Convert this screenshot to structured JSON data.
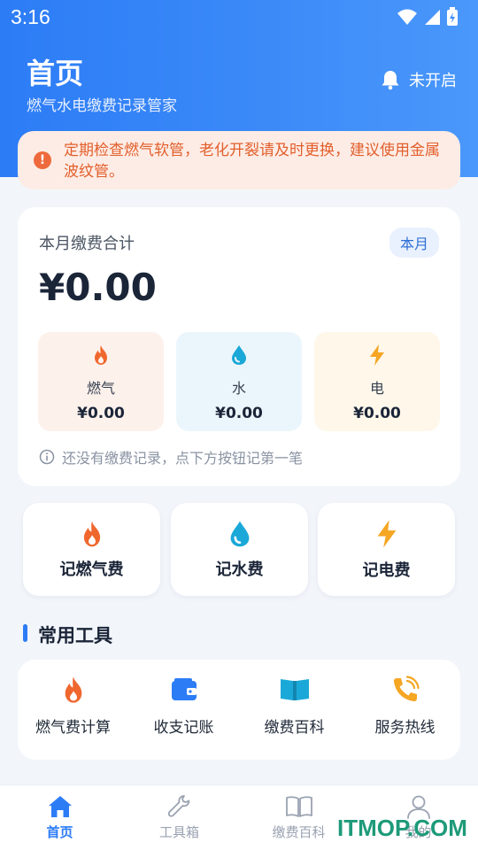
{
  "status_bar": {
    "time": "3:16"
  },
  "header": {
    "title": "首页",
    "subtitle": "燃气水电缴费记录管家",
    "reminder_label": "未开启"
  },
  "notice": {
    "icon": "alert-circle-icon",
    "text": "定期检查燃气软管，老化开裂请及时更换，建议使用金属波纹管。"
  },
  "summary": {
    "label": "本月缴费合计",
    "period": "本月",
    "total": "¥0.00",
    "utilities": [
      {
        "name": "燃气",
        "value": "¥0.00",
        "icon": "flame-icon",
        "color": "#f0672e"
      },
      {
        "name": "水",
        "value": "¥0.00",
        "icon": "water-drop-icon",
        "color": "#1aa8d8"
      },
      {
        "name": "电",
        "value": "¥0.00",
        "icon": "lightning-icon",
        "color": "#f5a623"
      }
    ],
    "empty_hint": "还没有缴费记录，点下方按钮记第一笔"
  },
  "actions": [
    {
      "label": "记燃气费",
      "icon": "flame-icon"
    },
    {
      "label": "记水费",
      "icon": "water-drop-icon"
    },
    {
      "label": "记电费",
      "icon": "lightning-icon"
    }
  ],
  "tools_section": {
    "title": "常用工具",
    "items": [
      {
        "label": "燃气费计算",
        "icon": "flame-icon"
      },
      {
        "label": "收支记账",
        "icon": "wallet-icon"
      },
      {
        "label": "缴费百科",
        "icon": "book-icon"
      },
      {
        "label": "服务热线",
        "icon": "phone-icon"
      }
    ]
  },
  "tabbar": {
    "items": [
      {
        "label": "首页",
        "icon": "home-icon",
        "active": true
      },
      {
        "label": "工具箱",
        "icon": "wrench-icon",
        "active": false
      },
      {
        "label": "缴费百科",
        "icon": "book-icon",
        "active": false
      },
      {
        "label": "我的",
        "icon": "user-icon",
        "active": false
      }
    ]
  },
  "watermark": "ITMOP.COM",
  "colors": {
    "primary": "#2c7cf6",
    "gas": "#f0672e",
    "water": "#1aa8d8",
    "electric": "#f5a623",
    "notice_text": "#e25f2c"
  }
}
